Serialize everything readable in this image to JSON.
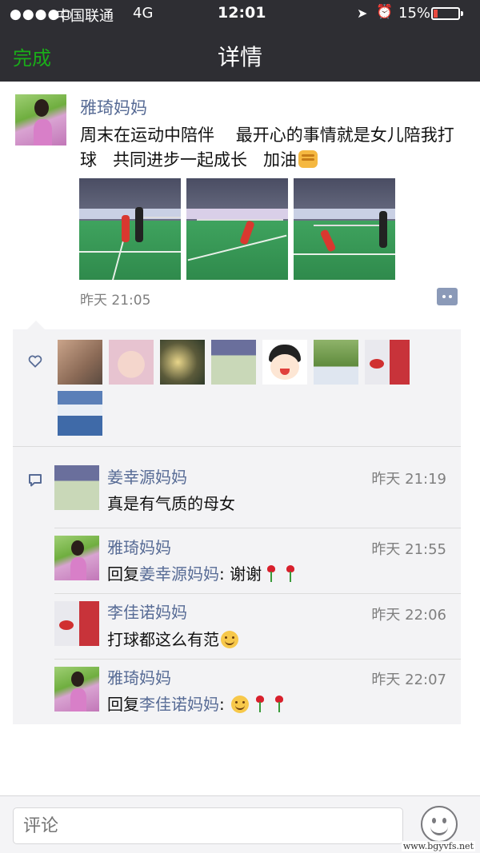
{
  "status_bar": {
    "signal": "●●●●○",
    "carrier": "中国联通",
    "network": "4G",
    "time": "12:01",
    "battery": "15%",
    "battery_level": 0.15
  },
  "nav": {
    "done_label": "完成",
    "title": "详情"
  },
  "post": {
    "author": "雅琦妈妈",
    "text": "周末在运动中陪伴    最开心的事情就是女儿陪我打球   共同进步一起成长   加油",
    "time": "昨天 21:05",
    "photos_count": 3
  },
  "likes": {
    "count": 8
  },
  "comments": [
    {
      "author": "姜幸源妈妈",
      "time": "昨天 21:19",
      "text": "真是有气质的母女"
    },
    {
      "author": "雅琦妈妈",
      "time": "昨天 21:55",
      "reply_prefix": "回复",
      "reply_to": "姜幸源妈妈",
      "text": ": 谢谢"
    },
    {
      "author": "李佳诺妈妈",
      "time": "昨天 22:06",
      "text": "打球都这么有范"
    },
    {
      "author": "雅琦妈妈",
      "time": "昨天 22:07",
      "reply_prefix": "回复",
      "reply_to": "李佳诺妈妈",
      "text": ": "
    }
  ],
  "input": {
    "placeholder": "评论"
  },
  "watermark": "www.bgyvfs.net",
  "colors": {
    "accent_green": "#1aad19",
    "name_blue": "#576b95",
    "nav_bg": "#2e2e33",
    "battery_low": "#e84a3f"
  }
}
